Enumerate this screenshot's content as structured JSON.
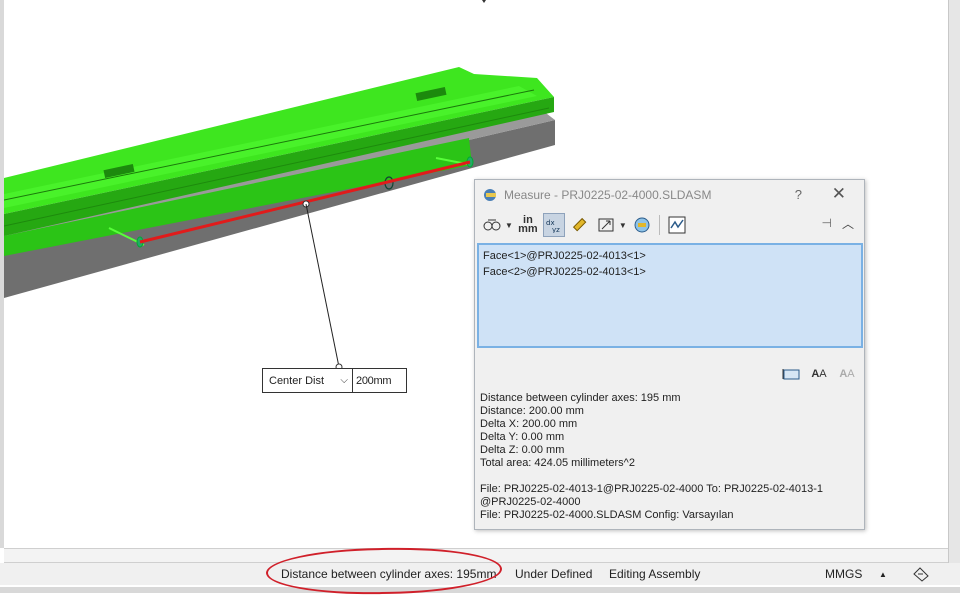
{
  "dimension": {
    "type_label": "Center Dist",
    "value": "200mm"
  },
  "measure": {
    "title": "Measure - PRJ0225-02-4000.SLDASM",
    "help": "?",
    "close": "✕",
    "toolbar": {
      "units_in": "in",
      "units_mm": "mm"
    },
    "selections": [
      "Face<1>@PRJ0225-02-4013<1>",
      "Face<2>@PRJ0225-02-4013<1>"
    ],
    "results": [
      "Distance between cylinder axes:  195 mm",
      "Distance: 200.00 mm",
      "Delta X: 200.00 mm",
      "Delta Y: 0.00 mm",
      "Delta Z: 0.00 mm",
      "Total area: 424.05 millimeters^2"
    ],
    "files": [
      "File: PRJ0225-02-4013-1@PRJ0225-02-4000 To: PRJ0225-02-4013-1",
      "@PRJ0225-02-4000",
      "File: PRJ0225-02-4000.SLDASM Config: Varsayılan"
    ]
  },
  "statusbar": {
    "measure_text": "Distance between cylinder axes: 195mm",
    "definition": "Under Defined",
    "mode": "Editing Assembly",
    "units": "MMGS",
    "units_arrow": "▲"
  },
  "colors": {
    "green": "#33dd1a",
    "gray": "#8e8e8e",
    "red_line": "#e11b1b",
    "highlight": "#d0202a",
    "selection_bg": "#cfe2f6"
  }
}
